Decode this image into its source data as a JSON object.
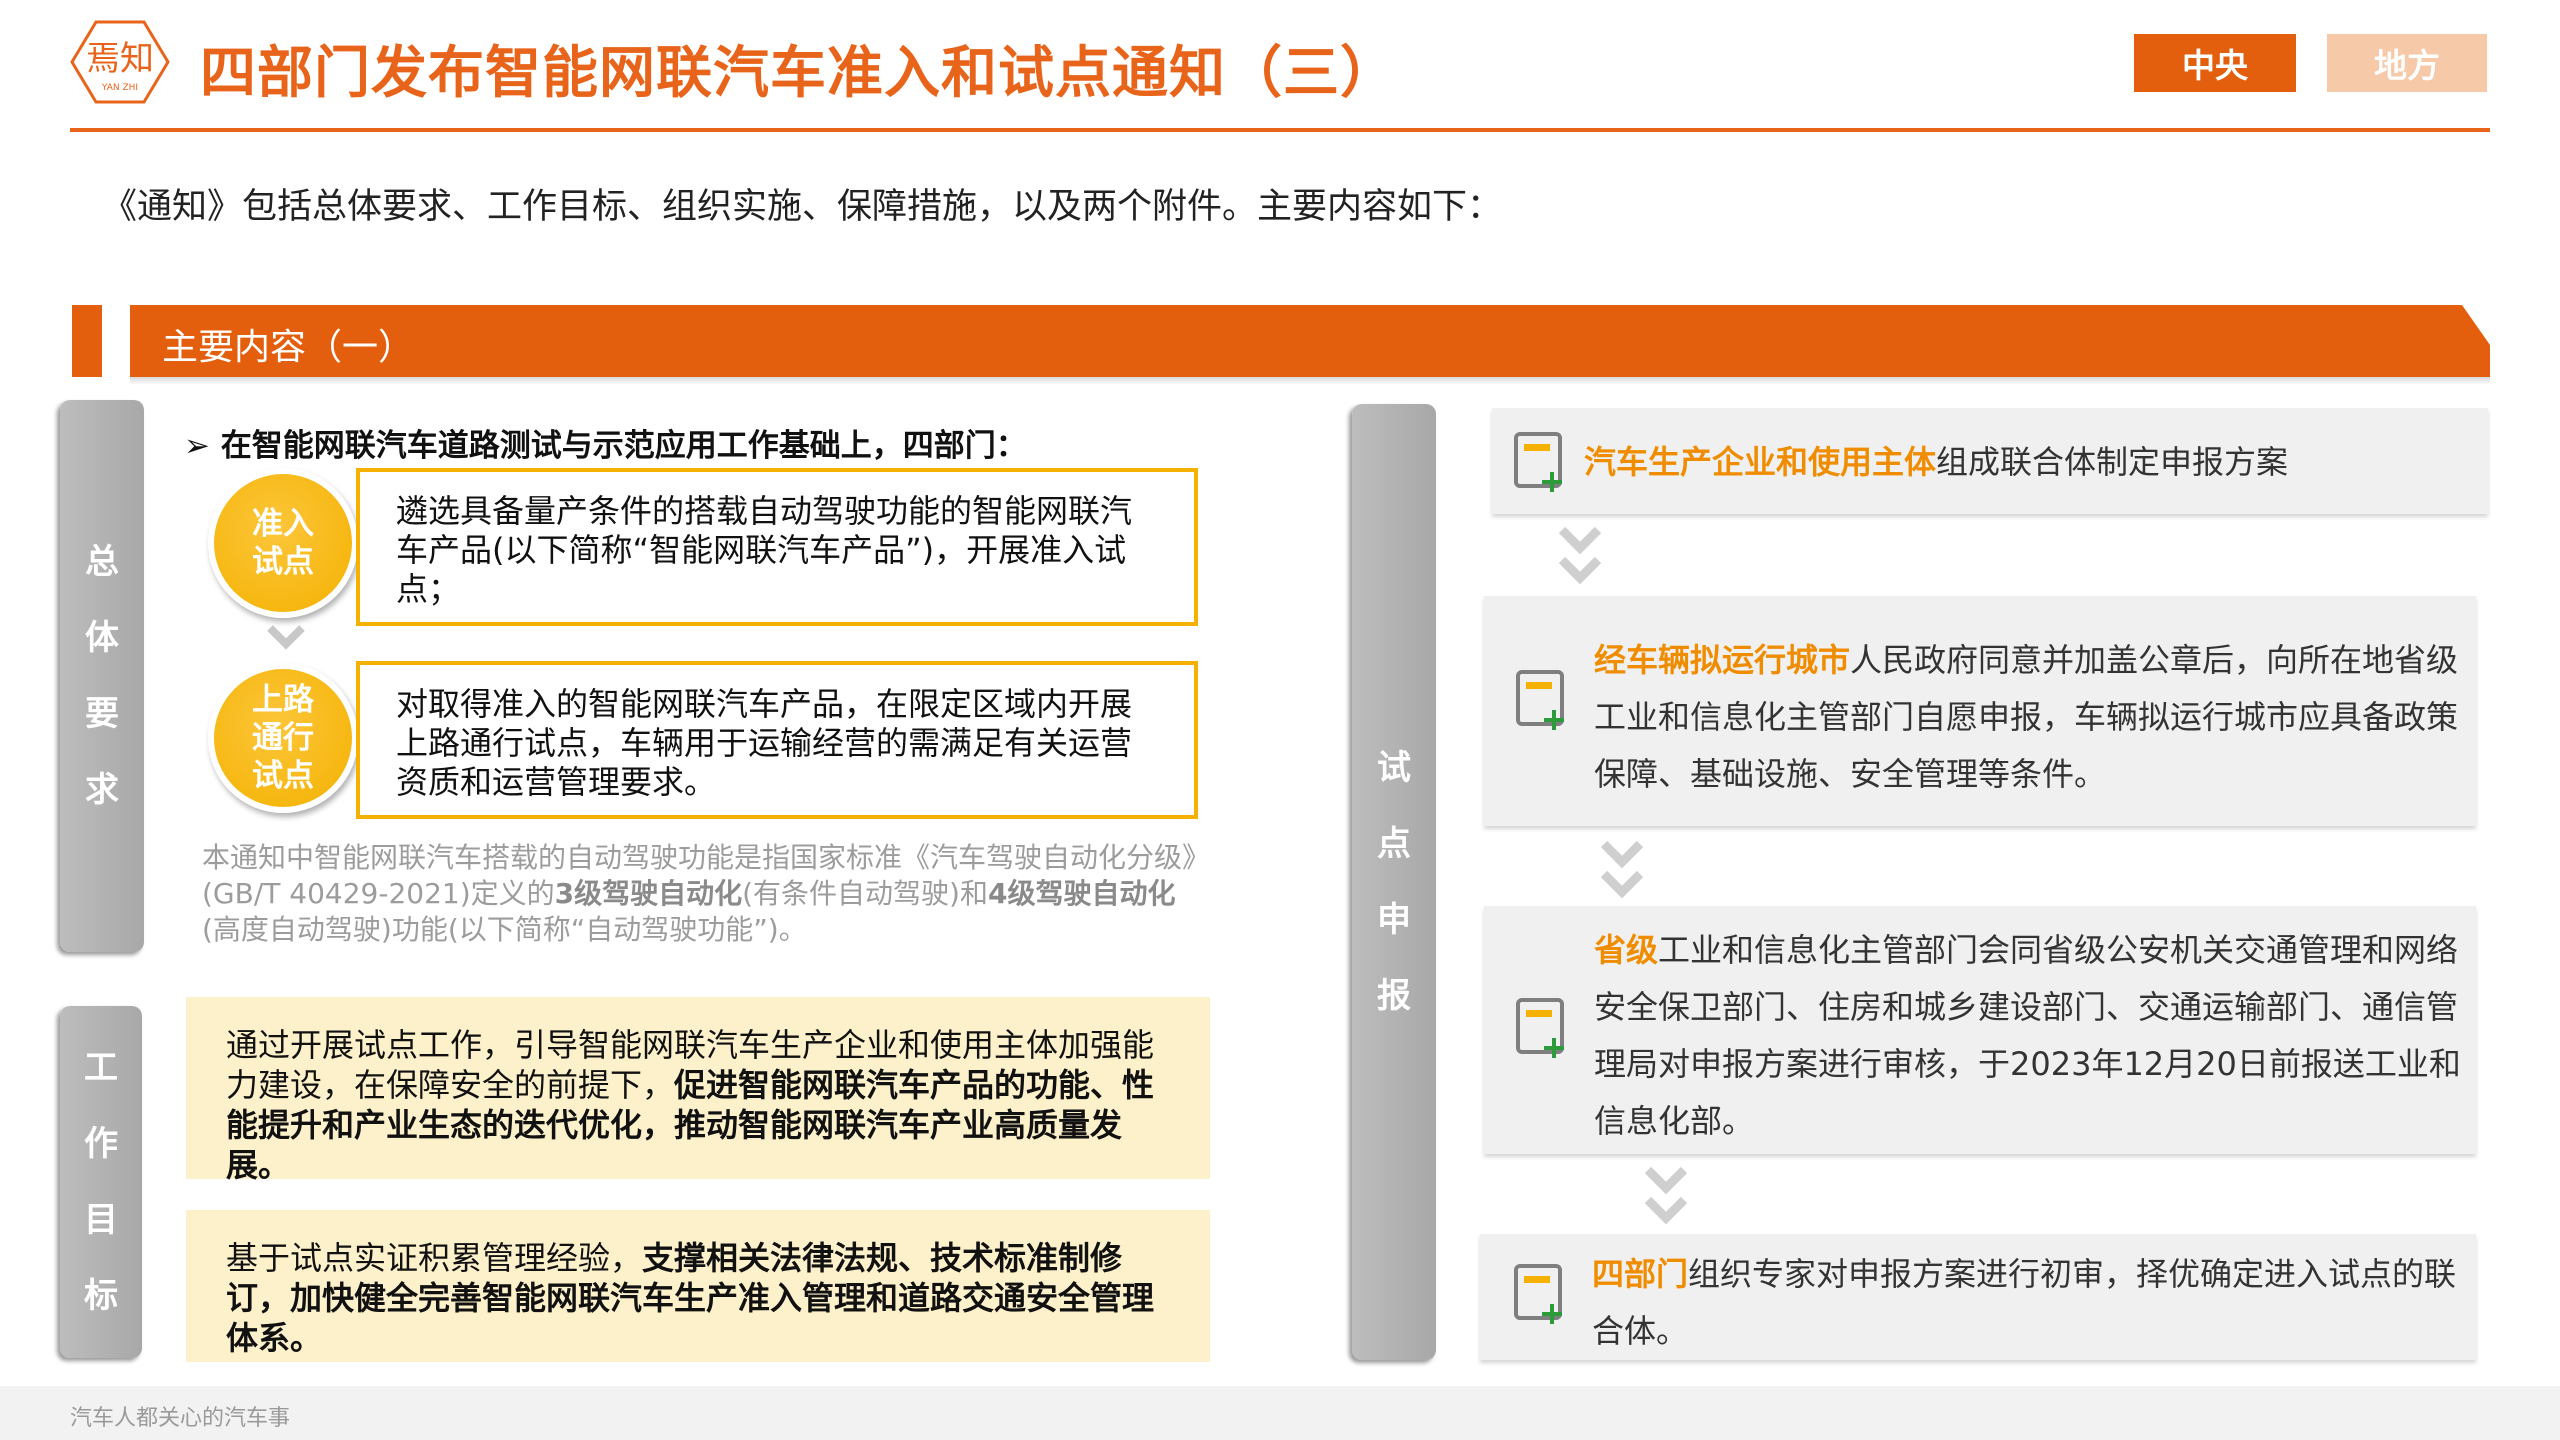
{
  "header": {
    "logo_text": "焉知",
    "logo_sub": "YAN ZHI",
    "title": "四部门发布智能网联汽车准入和试点通知（三）",
    "tabs": [
      "中央",
      "地方"
    ],
    "colors": {
      "accent": "#e8641b",
      "tab_active": "#e35f0e",
      "tab_inactive": "#f6c9a8"
    }
  },
  "intro": "《通知》包括总体要求、工作目标、组织实施、保障措施，以及两个附件。主要内容如下：",
  "section": {
    "title": "主要内容（一）"
  },
  "overall": {
    "label": [
      "总",
      "体",
      "要",
      "求"
    ],
    "bullet": "在智能网联汽车道路测试与示范应用工作基础上，四部门：",
    "items": [
      {
        "badge": [
          "准入",
          "试点"
        ],
        "text": "遴选具备量产条件的搭载自动驾驶功能的智能网联汽车产品(以下简称“智能网联汽车产品”)，开展准入试点；"
      },
      {
        "badge": [
          "上路",
          "通行",
          "试点"
        ],
        "text": "对取得准入的智能网联汽车产品，在限定区域内开展上路通行试点，车辆用于运输经营的需满足有关运营资质和运营管理要求。"
      }
    ],
    "note": {
      "p1": "本通知中智能网联汽车搭载的自动驾驶功能是指国家标准《汽车驾驶自动化分级》(GB/T 40429-2021)定义的",
      "b1": "3级驾驶自动化",
      "p2": "(有条件自动驾驶)和",
      "b2": "4级驾驶自动化",
      "p3": "(高度自动驾驶)功能(以下简称“自动驾驶功能”)。"
    }
  },
  "goals": {
    "label": [
      "工",
      "作",
      "目",
      "标"
    ],
    "items": [
      {
        "normal": "通过开展试点工作，引导智能网联汽车生产企业和使用主体加强能力建设，在保障安全的前提下，",
        "bold": "促进智能网联汽车产品的功能、性能提升和产业生态的迭代优化，推动智能网联汽车产业高质量发展。"
      },
      {
        "normal": "基于试点实证积累管理经验，",
        "bold": "支撑相关法律法规、技术标准制修订，加快健全完善智能网联汽车生产准入管理和道路交通安全管理体系。"
      }
    ]
  },
  "application": {
    "label": [
      "试",
      "点",
      "申",
      "报"
    ],
    "steps": [
      {
        "highlight": "汽车生产企业和使用主体",
        "text": "组成联合体制定申报方案"
      },
      {
        "highlight": "经车辆拟运行城市",
        "text": "人民政府同意并加盖公章后，向所在地省级工业和信息化主管部门自愿申报，车辆拟运行城市应具备政策保障、基础设施、安全管理等条件。"
      },
      {
        "highlight": "省级",
        "text": "工业和信息化主管部门会同省级公安机关交通管理和网络安全保卫部门、住房和城乡建设部门、交通运输部门、通信管理局对申报方案进行审核，于2023年12月20日前报送工业和信息化部。"
      },
      {
        "highlight": "四部门",
        "text": "组织专家对申报方案进行初审，择优确定进入试点的联合体。"
      }
    ],
    "highlight_color": "#f08c00"
  },
  "footer": {
    "text": "汽车人都关心的汽车事"
  }
}
